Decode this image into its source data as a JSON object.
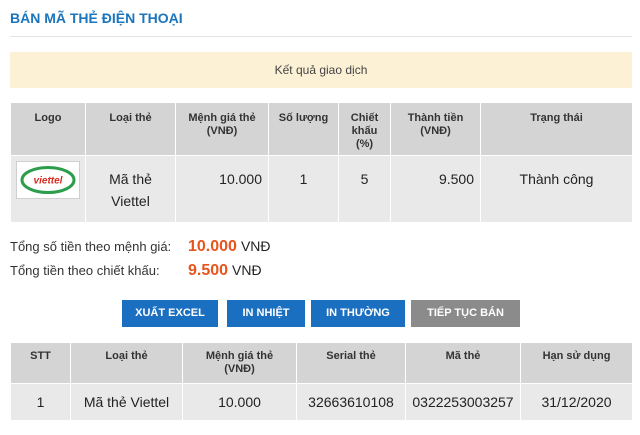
{
  "header": {
    "title": "BÁN MÃ THẺ ĐIỆN THOẠI"
  },
  "result": {
    "banner_text": "Kết quả giao dịch"
  },
  "transaction_table": {
    "columns": {
      "logo": "Logo",
      "card_type": "Loại thẻ",
      "face_value": "Mệnh giá thẻ (VNĐ)",
      "quantity": "Số lượng",
      "discount": "Chiết khấu (%)",
      "amount": "Thành tiền (VNĐ)",
      "status": "Trạng thái"
    },
    "rows": [
      {
        "logo_icon": "viettel-logo",
        "logo_text": "viettel",
        "card_type": "Mã thẻ Viettel",
        "face_value": "10.000",
        "quantity": "1",
        "discount": "5",
        "amount": "9.500",
        "status": "Thành công"
      }
    ]
  },
  "totals": {
    "face_value_label": "Tổng số tiền theo mệnh giá:",
    "face_value_amount": "10.000",
    "face_value_currency": "VNĐ",
    "discounted_label": "Tổng tiền theo chiết khấu:",
    "discounted_amount": "9.500",
    "discounted_currency": "VNĐ"
  },
  "actions": {
    "export_excel": "XUẤT EXCEL",
    "print_thermal": "IN NHIỆT",
    "print_normal": "IN THƯỜNG",
    "continue_selling": "TIẾP TỤC BÁN"
  },
  "cards_table": {
    "columns": {
      "index": "STT",
      "card_type": "Loại thẻ",
      "face_value": "Mệnh giá thẻ (VNĐ)",
      "serial": "Serial thẻ",
      "code": "Mã thẻ",
      "expiry": "Hạn sử dụng"
    },
    "rows": [
      {
        "index": "1",
        "card_type": "Mã thẻ Viettel",
        "face_value": "10.000",
        "serial": "32663610108",
        "code": "0322253003257",
        "expiry": "31/12/2020"
      }
    ]
  },
  "colors": {
    "accent": "#1a75bc",
    "button_blue": "#1b6fc0",
    "button_gray": "#8b8b8b",
    "highlight": "#e8541b",
    "banner_bg": "#fcf1d5",
    "header_bg": "#d4d4d4",
    "row_bg": "#e9e9e9",
    "logo_green": "#2b9d4b",
    "logo_red": "#d52b1e"
  }
}
